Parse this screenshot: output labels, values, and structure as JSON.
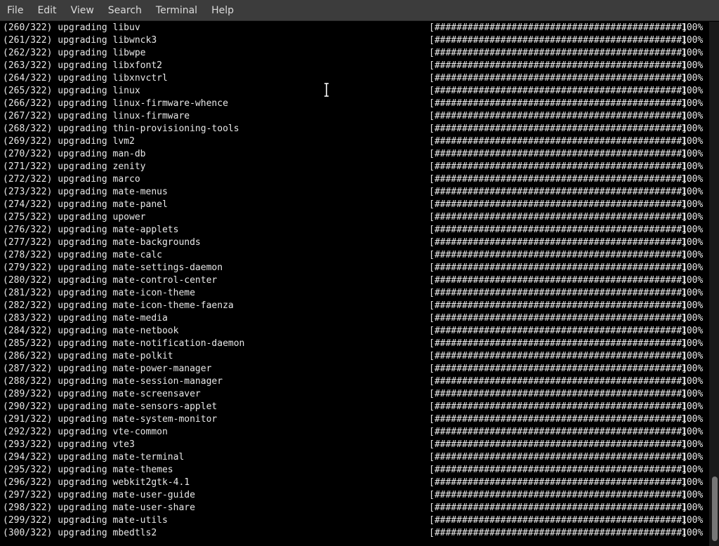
{
  "menu": [
    "File",
    "Edit",
    "View",
    "Search",
    "Terminal",
    "Help"
  ],
  "progress_bar": "[#############################################]",
  "percent": "100%",
  "lines": [
    "(260/322) upgrading libuv",
    "(261/322) upgrading libwnck3",
    "(262/322) upgrading libwpe",
    "(263/322) upgrading libxfont2",
    "(264/322) upgrading libxnvctrl",
    "(265/322) upgrading linux",
    "(266/322) upgrading linux-firmware-whence",
    "(267/322) upgrading linux-firmware",
    "(268/322) upgrading thin-provisioning-tools",
    "(269/322) upgrading lvm2",
    "(270/322) upgrading man-db",
    "(271/322) upgrading zenity",
    "(272/322) upgrading marco",
    "(273/322) upgrading mate-menus",
    "(274/322) upgrading mate-panel",
    "(275/322) upgrading upower",
    "(276/322) upgrading mate-applets",
    "(277/322) upgrading mate-backgrounds",
    "(278/322) upgrading mate-calc",
    "(279/322) upgrading mate-settings-daemon",
    "(280/322) upgrading mate-control-center",
    "(281/322) upgrading mate-icon-theme",
    "(282/322) upgrading mate-icon-theme-faenza",
    "(283/322) upgrading mate-media",
    "(284/322) upgrading mate-netbook",
    "(285/322) upgrading mate-notification-daemon",
    "(286/322) upgrading mate-polkit",
    "(287/322) upgrading mate-power-manager",
    "(288/322) upgrading mate-session-manager",
    "(289/322) upgrading mate-screensaver",
    "(290/322) upgrading mate-sensors-applet",
    "(291/322) upgrading mate-system-monitor",
    "(292/322) upgrading vte-common",
    "(293/322) upgrading vte3",
    "(294/322) upgrading mate-terminal",
    "(295/322) upgrading mate-themes",
    "(296/322) upgrading webkit2gtk-4.1",
    "(297/322) upgrading mate-user-guide",
    "(298/322) upgrading mate-user-share",
    "(299/322) upgrading mate-utils",
    "(300/322) upgrading mbedtls2"
  ],
  "colors": {
    "menubar": "#3c3c3c",
    "terminal_bg": "#000000",
    "text": "#e8e8e8"
  }
}
